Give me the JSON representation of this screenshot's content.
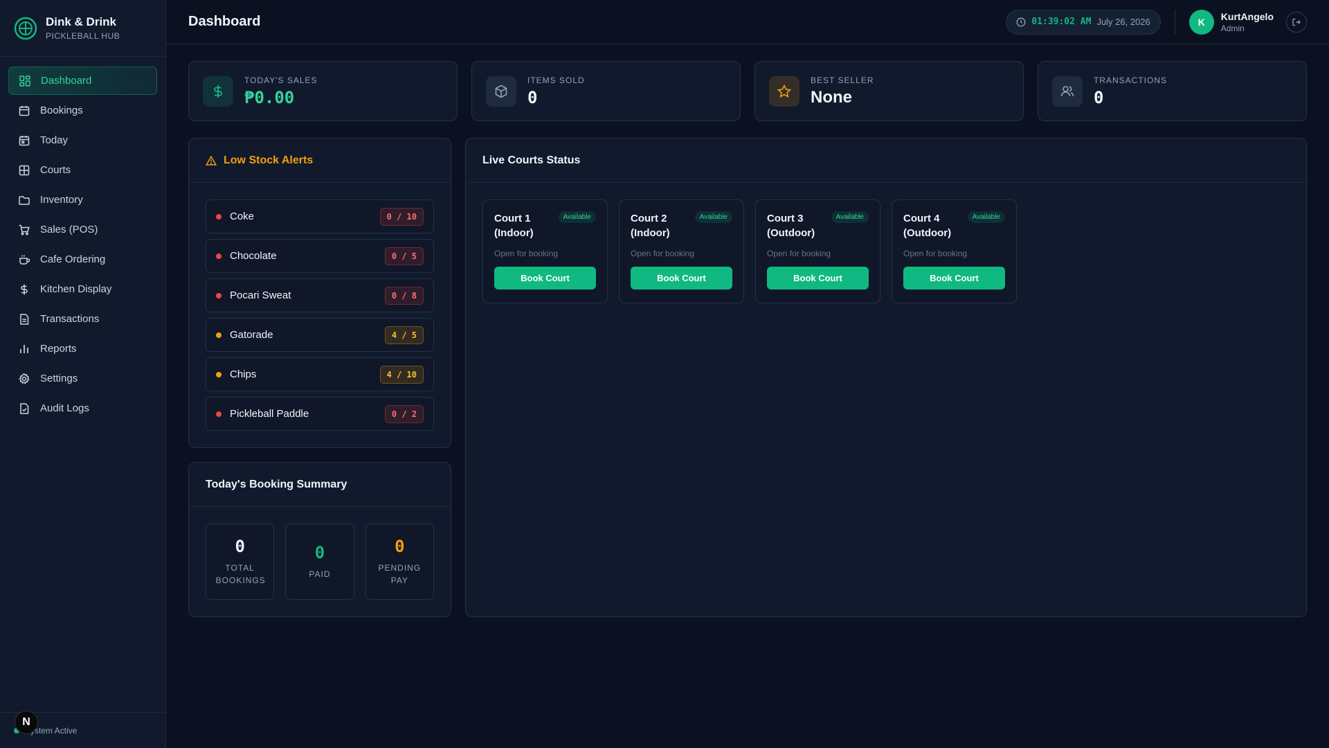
{
  "brand": {
    "title": "Dink & Drink",
    "subtitle": "PICKLEBALL HUB"
  },
  "nav": [
    {
      "label": "Dashboard",
      "icon": "dashboard-icon",
      "active": true
    },
    {
      "label": "Bookings",
      "icon": "calendar-icon"
    },
    {
      "label": "Today",
      "icon": "calendar-day-icon"
    },
    {
      "label": "Courts",
      "icon": "court-grid-icon"
    },
    {
      "label": "Inventory",
      "icon": "folder-icon"
    },
    {
      "label": "Sales (POS)",
      "icon": "cart-icon"
    },
    {
      "label": "Cafe Ordering",
      "icon": "coffee-icon"
    },
    {
      "label": "Kitchen Display",
      "icon": "dollar-icon"
    },
    {
      "label": "Transactions",
      "icon": "document-icon"
    },
    {
      "label": "Reports",
      "icon": "bar-chart-icon"
    },
    {
      "label": "Settings",
      "icon": "gear-icon"
    },
    {
      "label": "Audit Logs",
      "icon": "audit-doc-icon"
    }
  ],
  "footer": {
    "status": "System Active",
    "badge": "N"
  },
  "header": {
    "title": "Dashboard",
    "time": "01:39:02 AM",
    "date": "July 26, 2026",
    "user_initial": "K",
    "user_name": "KurtAngelo",
    "user_role": "Admin"
  },
  "stats": [
    {
      "label": "TODAY'S SALES",
      "value": "₱0.00",
      "icon": "dollar-icon"
    },
    {
      "label": "ITEMS SOLD",
      "value": "0",
      "icon": "box-icon"
    },
    {
      "label": "BEST SELLER",
      "value": "None",
      "icon": "star-icon"
    },
    {
      "label": "TRANSACTIONS",
      "value": "0",
      "icon": "users-icon"
    }
  ],
  "low_stock": {
    "title": "Low Stock Alerts",
    "items": [
      {
        "name": "Coke",
        "stock": "0 / 10",
        "level": "out"
      },
      {
        "name": "Chocolate",
        "stock": "0 / 5",
        "level": "out"
      },
      {
        "name": "Pocari Sweat",
        "stock": "0 / 8",
        "level": "out"
      },
      {
        "name": "Gatorade",
        "stock": "4 / 5",
        "level": "low"
      },
      {
        "name": "Chips",
        "stock": "4 / 10",
        "level": "low"
      },
      {
        "name": "Pickleball Paddle",
        "stock": "0 / 2",
        "level": "out"
      }
    ]
  },
  "booking_summary": {
    "title": "Today's Booking Summary",
    "total": {
      "value": "0",
      "label": "TOTAL BOOKINGS"
    },
    "paid": {
      "value": "0",
      "label": "PAID"
    },
    "pending": {
      "value": "0",
      "label": "PENDING PAY"
    }
  },
  "courts": {
    "title": "Live Courts Status",
    "items": [
      {
        "name": "Court 1 (Indoor)",
        "status": "Available",
        "sub": "Open for booking",
        "action": "Book Court"
      },
      {
        "name": "Court 2 (Indoor)",
        "status": "Available",
        "sub": "Open for booking",
        "action": "Book Court"
      },
      {
        "name": "Court 3 (Outdoor)",
        "status": "Available",
        "sub": "Open for booking",
        "action": "Book Court"
      },
      {
        "name": "Court 4 (Outdoor)",
        "status": "Available",
        "sub": "Open for booking",
        "action": "Book Court"
      }
    ]
  },
  "colors": {
    "accent": "#10b981",
    "warning": "#f59e0b",
    "danger": "#ef4444",
    "background": "#0b1120",
    "panel": "#111a2c"
  }
}
